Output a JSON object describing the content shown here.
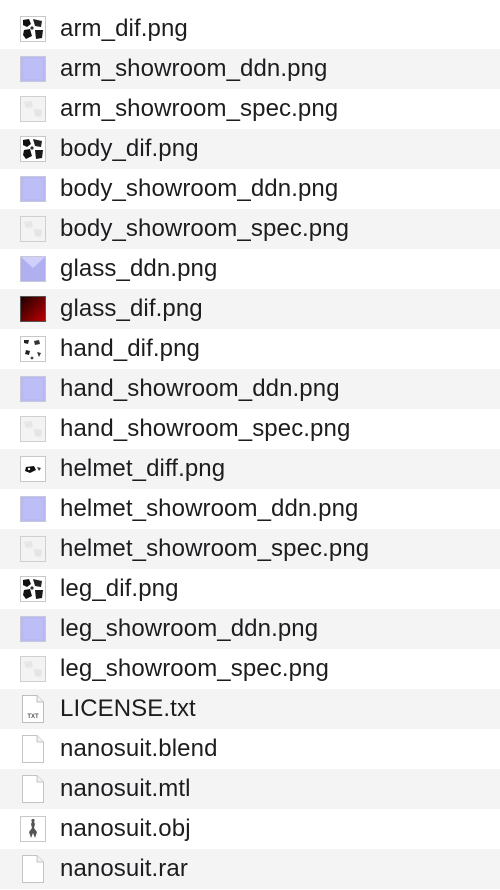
{
  "files": [
    {
      "name": "arm_dif.png",
      "icon": "image-diffuse-thumbnail-icon",
      "thumb": "dif"
    },
    {
      "name": "arm_showroom_ddn.png",
      "icon": "image-normal-map-thumbnail-icon",
      "thumb": "ddn"
    },
    {
      "name": "arm_showroom_spec.png",
      "icon": "image-specular-thumbnail-icon",
      "thumb": "spec"
    },
    {
      "name": "body_dif.png",
      "icon": "image-diffuse-thumbnail-icon",
      "thumb": "dif"
    },
    {
      "name": "body_showroom_ddn.png",
      "icon": "image-normal-map-thumbnail-icon",
      "thumb": "ddn"
    },
    {
      "name": "body_showroom_spec.png",
      "icon": "image-specular-thumbnail-icon",
      "thumb": "spec"
    },
    {
      "name": "glass_ddn.png",
      "icon": "image-normal-map-thumbnail-icon",
      "thumb": "glassddn"
    },
    {
      "name": "glass_dif.png",
      "icon": "image-glass-diffuse-thumbnail-icon",
      "thumb": "glassdif"
    },
    {
      "name": "hand_dif.png",
      "icon": "image-diffuse-thumbnail-icon",
      "thumb": "difsparse"
    },
    {
      "name": "hand_showroom_ddn.png",
      "icon": "image-normal-map-thumbnail-icon",
      "thumb": "ddn"
    },
    {
      "name": "hand_showroom_spec.png",
      "icon": "image-specular-thumbnail-icon",
      "thumb": "spec"
    },
    {
      "name": "helmet_diff.png",
      "icon": "image-diffuse-thumbnail-icon",
      "thumb": "difhelmet"
    },
    {
      "name": "helmet_showroom_ddn.png",
      "icon": "image-normal-map-thumbnail-icon",
      "thumb": "ddn"
    },
    {
      "name": "helmet_showroom_spec.png",
      "icon": "image-specular-thumbnail-icon",
      "thumb": "spec"
    },
    {
      "name": "leg_dif.png",
      "icon": "image-diffuse-thumbnail-icon",
      "thumb": "dif"
    },
    {
      "name": "leg_showroom_ddn.png",
      "icon": "image-normal-map-thumbnail-icon",
      "thumb": "ddn"
    },
    {
      "name": "leg_showroom_spec.png",
      "icon": "image-specular-thumbnail-icon",
      "thumb": "spec"
    },
    {
      "name": "LICENSE.txt",
      "icon": "text-document-icon",
      "thumb": "txt",
      "badge": "TXT"
    },
    {
      "name": "nanosuit.blend",
      "icon": "blank-document-icon",
      "thumb": "blank"
    },
    {
      "name": "nanosuit.mtl",
      "icon": "blank-document-icon",
      "thumb": "blank"
    },
    {
      "name": "nanosuit.obj",
      "icon": "3d-model-document-icon",
      "thumb": "obj"
    },
    {
      "name": "nanosuit.rar",
      "icon": "blank-document-icon",
      "thumb": "blank"
    }
  ],
  "colors": {
    "row_alt": "#f4f4f5",
    "text": "#1d1d1f",
    "normal_map": "#b8b8f4",
    "glass_dark": "#2a0000",
    "glass_red": "#b00000"
  }
}
